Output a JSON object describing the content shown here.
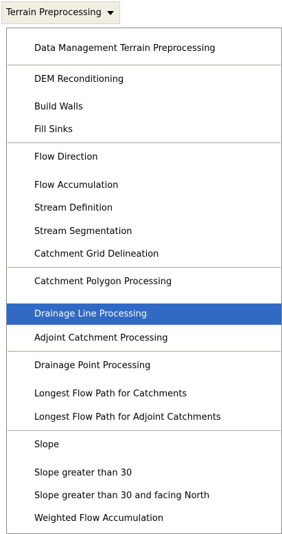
{
  "menubar": {
    "title": "Terrain Preprocessing",
    "dropdown_icon": "triangle-down-icon"
  },
  "menu": {
    "items": [
      {
        "label": "Data Management Terrain Preprocessing"
      },
      {
        "label": "DEM Reconditioning"
      },
      {
        "label": "Build Walls"
      },
      {
        "label": "Fill Sinks"
      },
      {
        "label": "Flow Direction"
      },
      {
        "label": "Flow Accumulation"
      },
      {
        "label": "Stream Definition"
      },
      {
        "label": "Stream Segmentation"
      },
      {
        "label": "Catchment Grid Delineation"
      },
      {
        "label": "Catchment Polygon Processing"
      },
      {
        "label": "Drainage Line Processing",
        "highlighted": true
      },
      {
        "label": "Adjoint Catchment Processing"
      },
      {
        "label": "Drainage Point Processing"
      },
      {
        "label": "Longest Flow Path for Catchments"
      },
      {
        "label": "Longest Flow Path for Adjoint Catchments"
      },
      {
        "label": "Slope"
      },
      {
        "label": "Slope greater than 30"
      },
      {
        "label": "Slope greater than 30 and facing North"
      },
      {
        "label": "Weighted Flow Accumulation"
      }
    ]
  },
  "colors": {
    "highlight": "#316ac5",
    "highlight_text": "#ffffff",
    "separator": "#aca899"
  }
}
